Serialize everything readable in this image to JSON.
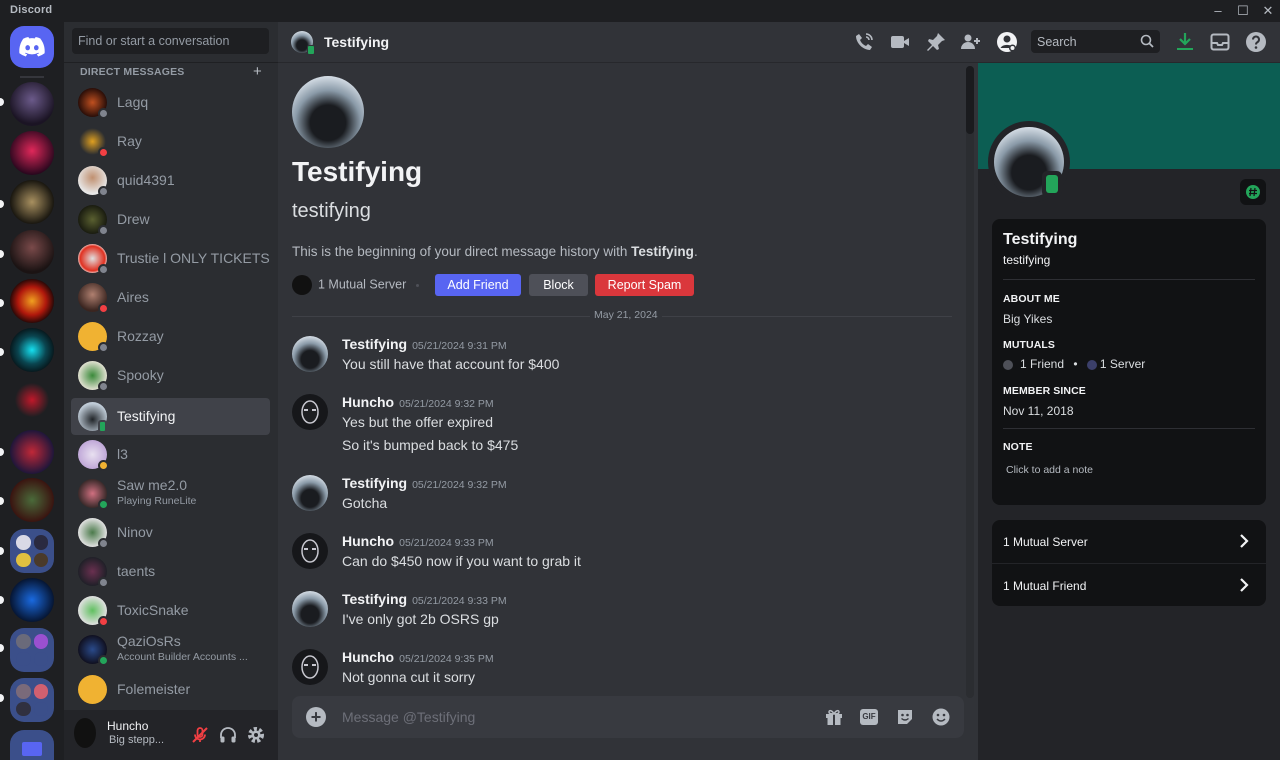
{
  "app": {
    "title": "Discord"
  },
  "window_controls": {
    "minimize": "–",
    "maximize": "☐",
    "close": "✕"
  },
  "colors": {
    "accent": "#5865f2",
    "online": "#23a55a",
    "dnd": "#f23f43",
    "idle": "#f0b232",
    "offline": "#80848e",
    "banner": "#0c5e53",
    "danger": "#da373c"
  },
  "sidebar": {
    "search_placeholder": "Find or start a conversation",
    "header": "DIRECT MESSAGES",
    "add_label": "+",
    "items": [
      {
        "name": "Lagq",
        "status": "offline"
      },
      {
        "name": "Ray",
        "status": "dnd"
      },
      {
        "name": "quid4391",
        "status": "offline"
      },
      {
        "name": "Drew",
        "status": "offline"
      },
      {
        "name": "Trustie l ONLY TICKETS",
        "status": "offline"
      },
      {
        "name": "Aires",
        "status": "dnd"
      },
      {
        "name": "Rozzay",
        "status": "offline"
      },
      {
        "name": "Spooky",
        "status": "offline"
      },
      {
        "name": "Testifying",
        "status": "mobile",
        "active": true
      },
      {
        "name": "l3",
        "status": "idle"
      },
      {
        "name": "Saw me2.0",
        "status": "online",
        "subtitle": "Playing RuneLite"
      },
      {
        "name": "Ninov",
        "status": "offline"
      },
      {
        "name": "taents",
        "status": "offline"
      },
      {
        "name": "ToxicSnake",
        "status": "dnd"
      },
      {
        "name": "QaziOsRs",
        "status": "online",
        "subtitle": "Account Builder Accounts ..."
      },
      {
        "name": "Folemeister",
        "status": "offline"
      }
    ]
  },
  "user_panel": {
    "name": "Huncho",
    "status_text": "Big stepp..."
  },
  "header": {
    "title": "Testifying",
    "search_placeholder": "Search"
  },
  "intro": {
    "display_name": "Testifying",
    "username": "testifying",
    "description_prefix": "This is the beginning of your direct message history with ",
    "description_name": "Testifying",
    "description_suffix": ".",
    "mutual_server": "1 Mutual Server",
    "add_friend": "Add Friend",
    "block": "Block",
    "report": "Report Spam"
  },
  "date_divider": "May 21, 2024",
  "messages": [
    {
      "author": "Testifying",
      "time": "05/21/2024 9:31 PM",
      "lines": [
        "You still have that account for $400"
      ]
    },
    {
      "author": "Huncho",
      "time": "05/21/2024 9:32 PM",
      "lines": [
        "Yes but the offer expired",
        "So it's bumped back to $475"
      ]
    },
    {
      "author": "Testifying",
      "time": "05/21/2024 9:32 PM",
      "lines": [
        "Gotcha"
      ]
    },
    {
      "author": "Huncho",
      "time": "05/21/2024 9:33 PM",
      "lines": [
        "Can do $450 now if you want to grab it"
      ]
    },
    {
      "author": "Testifying",
      "time": "05/21/2024 9:33 PM",
      "lines": [
        "I've only got 2b OSRS gp"
      ]
    },
    {
      "author": "Huncho",
      "time": "05/21/2024 9:35 PM",
      "lines": [
        "Not gonna cut it sorry"
      ]
    }
  ],
  "composer": {
    "placeholder": "Message @Testifying",
    "gif_label": "GIF"
  },
  "profile": {
    "display_name": "Testifying",
    "username": "testifying",
    "about_label": "ABOUT ME",
    "about_text": "Big Yikes",
    "mutuals_label": "MUTUALS",
    "mutual_friends": "1 Friend",
    "mutual_servers": "1 Server",
    "member_since_label": "MEMBER SINCE",
    "member_since": "Nov 11, 2018",
    "note_label": "NOTE",
    "note_placeholder": "Click to add a note",
    "mutual_server_row": "1 Mutual Server",
    "mutual_friend_row": "1 Mutual Friend"
  }
}
